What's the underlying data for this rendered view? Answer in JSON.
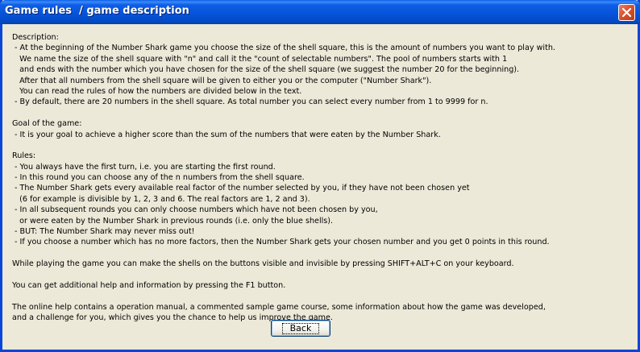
{
  "window": {
    "title": "Game rules  / game description",
    "close_icon": "close-icon"
  },
  "content": {
    "lines": [
      "Description:",
      " - At the beginning of the Number Shark game you choose the size of the shell square, this is the amount of numbers you want to play with.",
      "   We name the size of the shell square with \"n\" and call it the \"count of selectable numbers\". The pool of numbers starts with 1",
      "   and ends with the number which you have chosen for the size of the shell square (we suggest the number 20 for the beginning).",
      "   After that all numbers from the shell square will be given to either you or the computer (\"Number Shark\").",
      "   You can read the rules of how the numbers are divided below in the text.",
      " - By default, there are 20 numbers in the shell square. As total number you can select every number from 1 to 9999 for n.",
      "",
      "Goal of the game:",
      " - It is your goal to achieve a higher score than the sum of the numbers that were eaten by the Number Shark.",
      "",
      "Rules:",
      " - You always have the first turn, i.e. you are starting the first round.",
      " - In this round you can choose any of the n numbers from the shell square.",
      " - The Number Shark gets every available real factor of the number selected by you, if they have not been chosen yet",
      "   (6 for example is divisible by 1, 2, 3 and 6. The real factors are 1, 2 and 3).",
      " - In all subsequent rounds you can only choose numbers which have not been chosen by you,",
      "   or were eaten by the Number Shark in previous rounds (i.e. only the blue shells).",
      " - BUT: The Number Shark may never miss out!",
      " - If you choose a number which has no more factors, then the Number Shark gets your chosen number and you get 0 points in this round.",
      "",
      "While playing the game you can make the shells on the buttons visible and invisible by pressing SHIFT+ALT+C on your keyboard.",
      "",
      "You can get additional help and information by pressing the F1 button.",
      "",
      "The online help contains a operation manual, a commented sample game course, some information about how the game was developed,",
      "and a challenge for you, which gives you the chance to help us improve the game."
    ]
  },
  "buttons": {
    "back_label": "Back"
  }
}
